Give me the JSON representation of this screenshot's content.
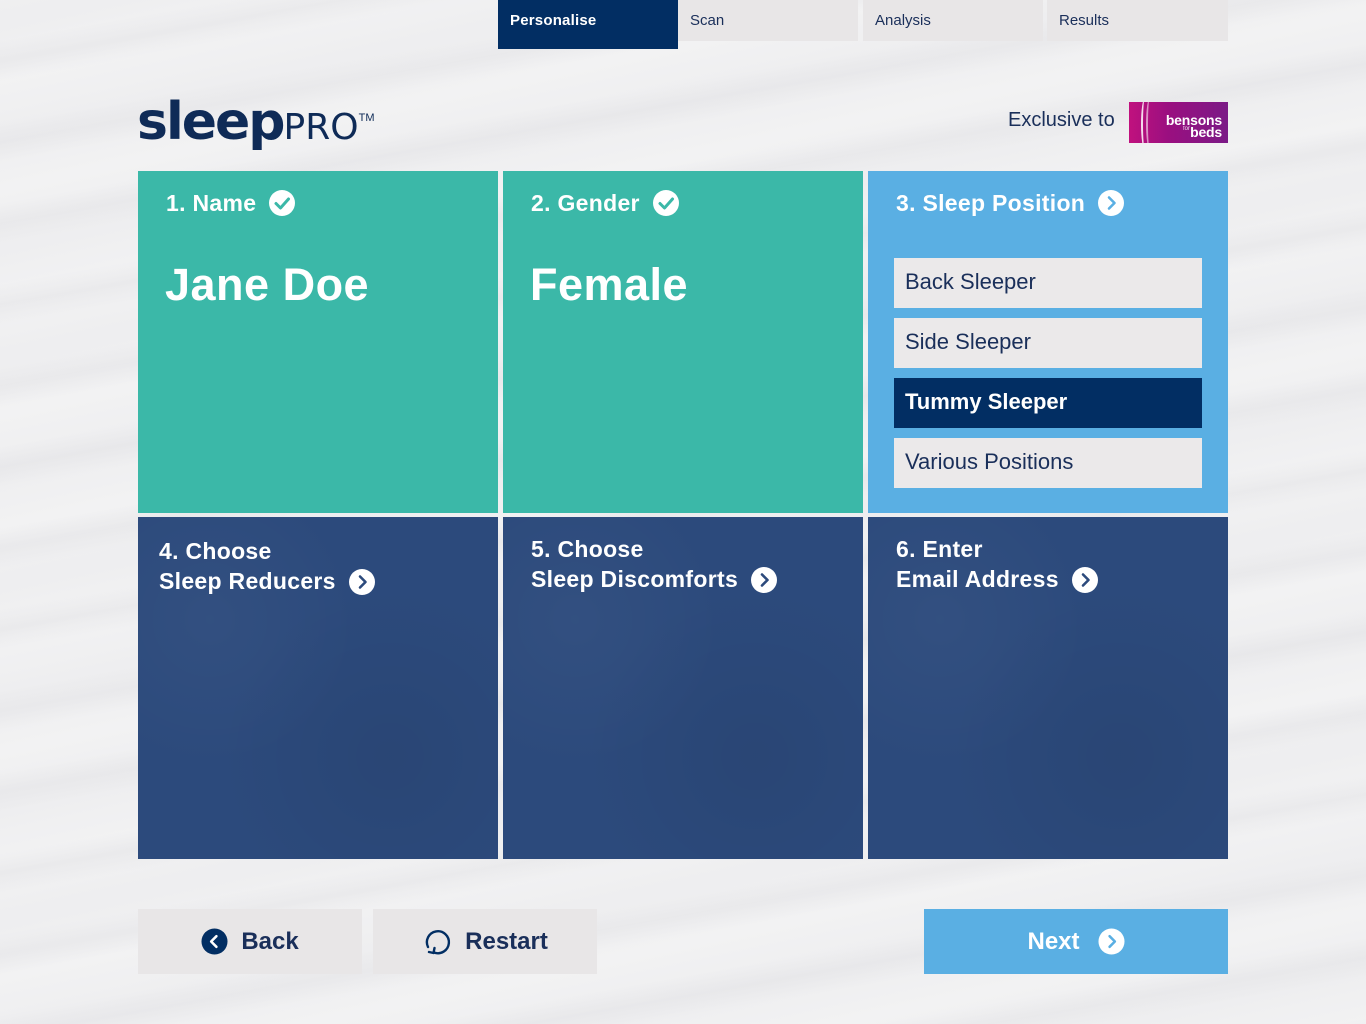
{
  "tabs": [
    {
      "label": "Personalise",
      "active": true
    },
    {
      "label": "Scan",
      "active": false
    },
    {
      "label": "Analysis",
      "active": false
    },
    {
      "label": "Results",
      "active": false
    }
  ],
  "header": {
    "logo_sleep": "sleep",
    "logo_pro": "PRO",
    "logo_tm": "TM",
    "exclusive_text": "Exclusive to",
    "partner_logo_line1": "bensons",
    "partner_logo_for": "for",
    "partner_logo_line2": "beds"
  },
  "steps": {
    "name": {
      "title": "1. Name",
      "value": "Jane Doe",
      "status_icon": "check-circle-icon"
    },
    "gender": {
      "title": "2. Gender",
      "value": "Female",
      "status_icon": "check-circle-icon"
    },
    "sleep_position": {
      "title": "3. Sleep Position",
      "status_icon": "chevron-right-circle-icon",
      "options": [
        "Back Sleeper",
        "Side Sleeper",
        "Tummy Sleeper",
        "Various Positions"
      ],
      "selected": "Tummy Sleeper"
    },
    "sleep_reducers": {
      "title_line1": "4. Choose",
      "title_line2": "Sleep Reducers",
      "status_icon": "chevron-right-circle-icon"
    },
    "sleep_discomforts": {
      "title_line1": "5. Choose",
      "title_line2": "Sleep Discomforts",
      "status_icon": "chevron-right-circle-icon"
    },
    "email": {
      "title_line1": "6. Enter",
      "title_line2": "Email Address",
      "status_icon": "chevron-right-circle-icon"
    }
  },
  "footer": {
    "back_label": "Back",
    "restart_label": "Restart",
    "next_label": "Next"
  },
  "colors": {
    "navy": "#022e63",
    "teal": "#3bb8a8",
    "sky": "#5aafe3",
    "panel_navy": "#2c4a7c",
    "light_grey": "#e8e6e7",
    "brand_magenta": "#a0117f"
  }
}
